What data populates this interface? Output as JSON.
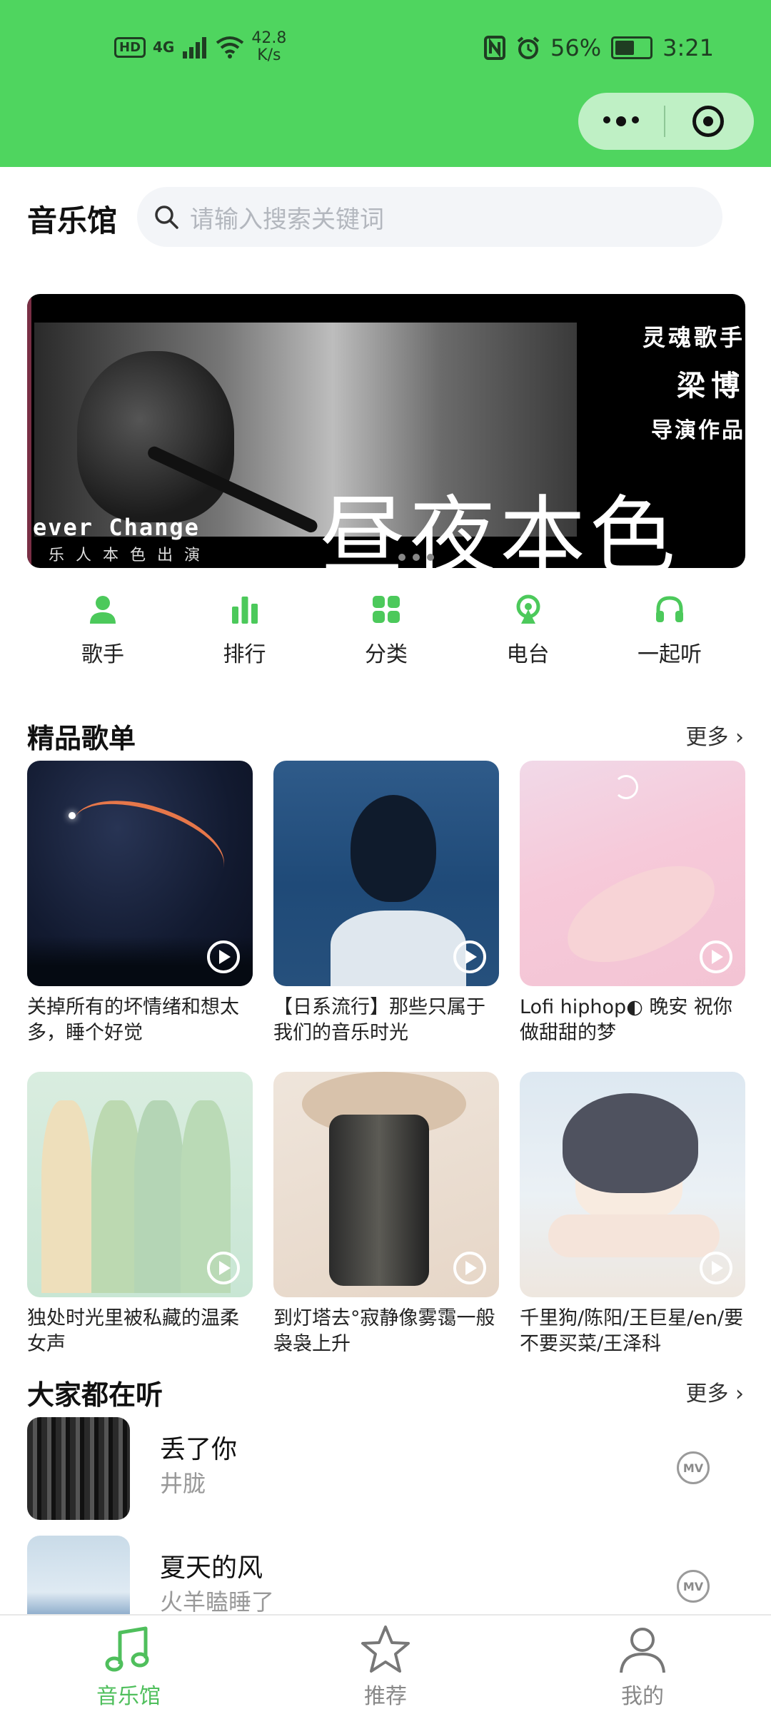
{
  "status_bar": {
    "hd": "HD",
    "net": "4G",
    "speed_value": "42.8",
    "speed_unit": "K/s",
    "battery": "56%",
    "battery_level": 0.56,
    "time": "3:21"
  },
  "header": {
    "title": "音乐馆",
    "search_placeholder": "请输入搜索关键词"
  },
  "banner": {
    "line1": "灵魂歌手",
    "line2": "梁博",
    "line3": "导演作品",
    "big_title": "昼夜本色",
    "english": "ever Change",
    "subtitle": "乐人本色出演"
  },
  "quick_entries": [
    {
      "label": "歌手",
      "icon": "person-icon"
    },
    {
      "label": "排行",
      "icon": "bar-chart-icon"
    },
    {
      "label": "分类",
      "icon": "grid-icon"
    },
    {
      "label": "电台",
      "icon": "radio-icon"
    },
    {
      "label": "一起听",
      "icon": "headphones-icon"
    }
  ],
  "playlists_section": {
    "title": "精品歌单",
    "more": "更多"
  },
  "playlists": [
    {
      "title": "关掉所有的坏情绪和想太多，睡个好觉"
    },
    {
      "title": "【日系流行】那些只属于我们的音乐时光"
    },
    {
      "title": "Lofi hiphop◐ 晚安 祝你做甜甜的梦"
    },
    {
      "title": "独处时光里被私藏的温柔女声"
    },
    {
      "title": "到灯塔去°寂静像雾霭一般袅袅上升"
    },
    {
      "title": "千里狗/陈阳/王巨星/en/要不要买菜/王泽科"
    }
  ],
  "listening_section": {
    "title": "大家都在听",
    "more": "更多"
  },
  "songs": [
    {
      "name": "丢了你",
      "artist": "井胧",
      "badge": "MV"
    },
    {
      "name": "夏天的风",
      "artist": "火羊瞌睡了",
      "badge": "MV"
    }
  ],
  "tabbar": [
    {
      "label": "音乐馆",
      "icon": "music-note-icon",
      "active": true
    },
    {
      "label": "推荐",
      "icon": "star-icon",
      "active": false
    },
    {
      "label": "我的",
      "icon": "user-icon",
      "active": false
    }
  ],
  "colors": {
    "brand_green": "#4fd55f",
    "active_tab": "#4fbf5c"
  }
}
